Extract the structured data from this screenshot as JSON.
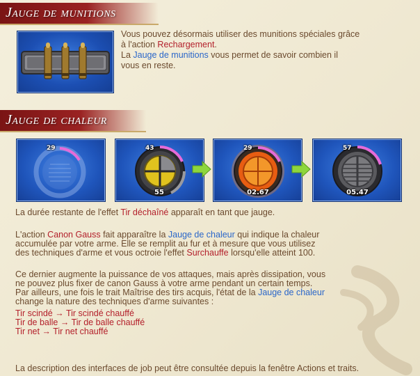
{
  "sections": {
    "ammo": {
      "title": "Jauge de munitions",
      "line1": "Vous pouvez désormais utiliser des munitions spéciales grâce",
      "line2_pre": "à l'action ",
      "line2_hl": "Rechargement",
      "line2_post": ".",
      "line3_pre": "La ",
      "line3_hl": "Jauge de munitions",
      "line3_post": " vous permet de savoir combien il",
      "line4": "vous en reste."
    },
    "heat": {
      "title": "Jauge de chaleur",
      "gauges": [
        {
          "top": "29",
          "bottom": ""
        },
        {
          "top": "43",
          "bottom": "55"
        },
        {
          "top": "29",
          "bottom": "02.67"
        },
        {
          "top": "57",
          "bottom": "05.47"
        }
      ],
      "p1_pre": "La durée restante de l'effet ",
      "p1_hl": "Tir déchaîné",
      "p1_post": " apparaît en tant que jauge.",
      "p2_a": "L'action ",
      "p2_hl1": "Canon Gauss",
      "p2_b": " fait apparaître la ",
      "p2_hl2": "Jauge de chaleur",
      "p2_c": " qui indique la chaleur",
      "p2_line2": "accumulée par votre arme. Elle se remplit au fur et à mesure que vous utilisez",
      "p2_line3_pre": "des techniques d'arme et vous octroie l'effet ",
      "p2_line3_hl": "Surchauffe",
      "p2_line3_post": " lorsqu'elle atteint 100.",
      "p3_line1": "Ce dernier augmente la puissance de vos attaques, mais après dissipation, vous",
      "p3_line2": "ne pouvez plus fixer de canon Gauss à votre arme pendant un certain temps.",
      "p3_line3_pre": "Par ailleurs, une fois le trait Maîtrise des tirs acquis, l'état de la ",
      "p3_line3_hl": "Jauge de chaleur",
      "p3_line4": "change la nature des techniques d'arme suivantes :",
      "weaponskills": [
        {
          "from": "Tir scindé",
          "to": "Tir scindé chauffé"
        },
        {
          "from": "Tir de balle",
          "to": "Tir de balle chauffé"
        },
        {
          "from": "Tir net",
          "to": "Tir net chauffé"
        }
      ],
      "arrow_glyph": "→"
    }
  },
  "footer": "La description des interfaces de job peut être consultée depuis la fenêtre Actions et traits.",
  "colors": {
    "header_bg": "#8c1c1c",
    "text": "#6b4a2e",
    "highlight_red": "#b3202b",
    "highlight_blue": "#2a66c9",
    "heat_arc": "#d04cc8",
    "arrow": "#8ed63c"
  }
}
